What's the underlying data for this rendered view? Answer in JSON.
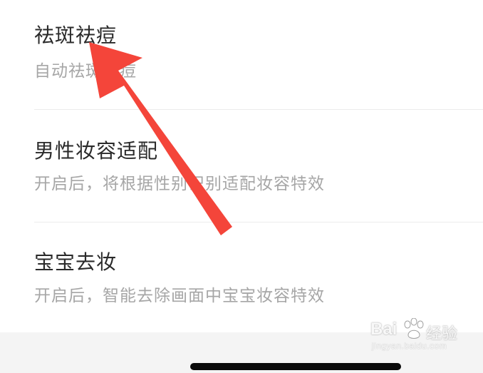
{
  "settings": {
    "items": [
      {
        "title": "祛斑祛痘",
        "subtitle": "自动祛斑祛痘"
      },
      {
        "title": "男性妆容适配",
        "subtitle": "开启后，将根据性别识别适配妆容特效"
      },
      {
        "title": "宝宝去妆",
        "subtitle": "开启后，智能去除画面中宝宝妆容特效"
      }
    ]
  },
  "annotation": {
    "arrow_color": "#f4453a"
  },
  "watermark": {
    "brand_left": "Bai",
    "brand_right": "经验",
    "url": "jingyan.baidu.com"
  },
  "colors": {
    "title": "#2a2a2a",
    "subtitle": "#a6a6a6",
    "divider": "#ececec",
    "bottom_bar": "#f4f4f4"
  }
}
